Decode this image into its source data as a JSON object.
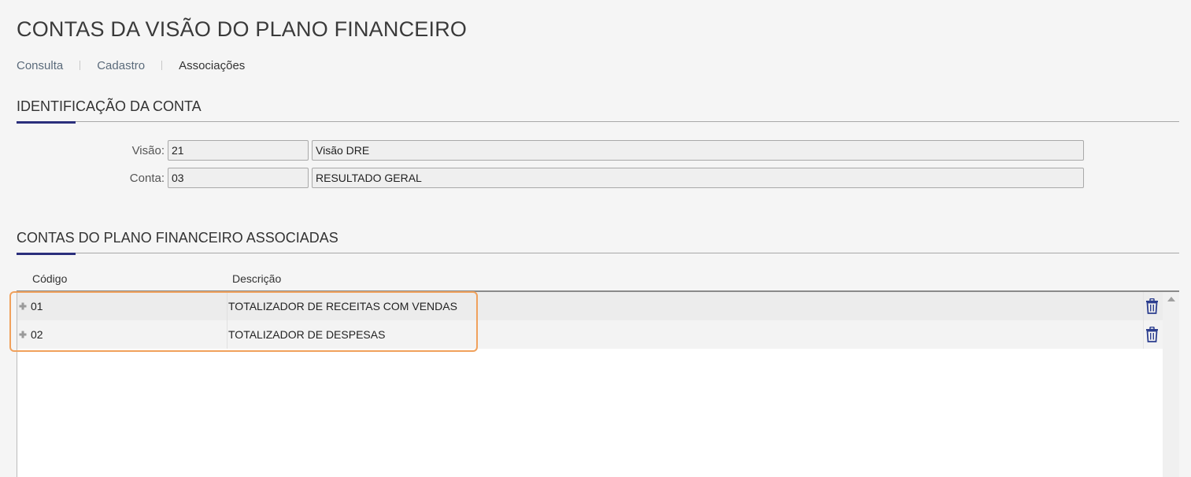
{
  "page": {
    "title": "CONTAS DA VISÃO DO PLANO FINANCEIRO"
  },
  "tabs": [
    {
      "label": "Consulta"
    },
    {
      "label": "Cadastro"
    },
    {
      "label": "Associações"
    }
  ],
  "identification": {
    "title": "IDENTIFICAÇÃO DA CONTA",
    "visao": {
      "label": "Visão:",
      "code": "21",
      "description": "Visão DRE"
    },
    "conta": {
      "label": "Conta:",
      "code": "03",
      "description": "RESULTADO GERAL"
    }
  },
  "associated": {
    "title": "CONTAS DO PLANO FINANCEIRO ASSOCIADAS",
    "columns": {
      "code": "Código",
      "description": "Descrição"
    },
    "rows": [
      {
        "code": "01",
        "description": "TOTALIZADOR DE RECEITAS COM VENDAS"
      },
      {
        "code": "02",
        "description": "TOTALIZADOR DE DESPESAS"
      }
    ]
  },
  "colors": {
    "accent": "#2b2f7c",
    "delete_icon": "#2c3e8f",
    "highlight": "#f0a15c"
  },
  "icons": {
    "expand": "plus-icon",
    "delete": "trash-icon",
    "scroll_up": "arrow-up-icon"
  }
}
